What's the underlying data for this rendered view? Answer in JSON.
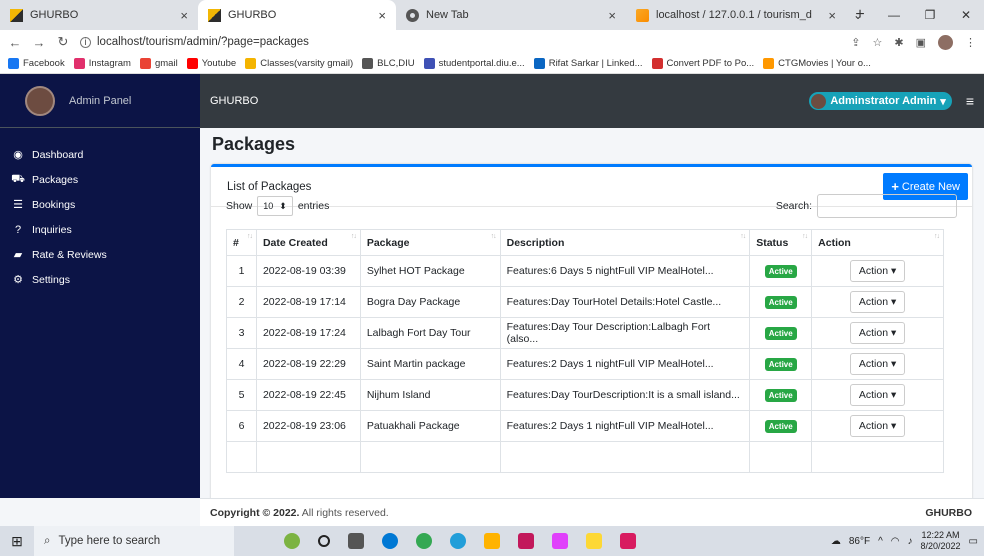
{
  "browser": {
    "tabs": [
      {
        "title": "GHURBO",
        "close": "×",
        "active": false,
        "fav": "ghurbo"
      },
      {
        "title": "GHURBO",
        "close": "×",
        "active": true,
        "fav": "ghurbo"
      },
      {
        "title": "New Tab",
        "close": "×",
        "active": false,
        "fav": "newtab"
      },
      {
        "title": "localhost / 127.0.0.1 / tourism_d",
        "close": "×",
        "active": false,
        "fav": "xampp"
      }
    ],
    "new_tab": "+",
    "url": "localhost/tourism/admin/?page=packages",
    "bookmarks": [
      {
        "label": "Facebook",
        "color": "#1877f2"
      },
      {
        "label": "Instagram",
        "color": "#e1306c"
      },
      {
        "label": "gmail",
        "color": "#ea4335"
      },
      {
        "label": "Youtube",
        "color": "#ff0000"
      },
      {
        "label": "Classes(varsity gmail)",
        "color": "#f4b400"
      },
      {
        "label": "BLC,DIU",
        "color": "#555555"
      },
      {
        "label": "studentportal.diu.e...",
        "color": "#3f51b5"
      },
      {
        "label": "Rifat Sarkar | Linked...",
        "color": "#0a66c2"
      },
      {
        "label": "Convert PDF to Po...",
        "color": "#d32f2f"
      },
      {
        "label": "CTGMovies | Your o...",
        "color": "#ff9800"
      }
    ]
  },
  "sidebar": {
    "brand": "Admin Panel",
    "items": [
      {
        "label": "Dashboard",
        "icon": "◉"
      },
      {
        "label": "Packages",
        "icon": "⛟"
      },
      {
        "label": "Bookings",
        "icon": "☰"
      },
      {
        "label": "Inquiries",
        "icon": "?"
      },
      {
        "label": "Rate & Reviews",
        "icon": "▰"
      },
      {
        "label": "Settings",
        "icon": "⚙"
      }
    ]
  },
  "topnav": {
    "title": "GHURBO",
    "user": "Adminstrator Admin",
    "caret": "▾",
    "menu_icon": "≡"
  },
  "page": {
    "title": "Packages",
    "card_title": "List of Packages",
    "create_btn": "Create New",
    "show": "Show",
    "entries_value": "10",
    "entries": "entries",
    "search_label": "Search:"
  },
  "table": {
    "headers": [
      "#",
      "Date Created",
      "Package",
      "Description",
      "Status",
      "Action"
    ],
    "rows": [
      {
        "num": "1",
        "date": "2022-08-19 03:39",
        "package": "Sylhet HOT Package",
        "desc": "Features:6 Days 5 nightFull VIP MealHotel...",
        "status": "Active",
        "action": "Action"
      },
      {
        "num": "2",
        "date": "2022-08-19 17:14",
        "package": "Bogra Day Package",
        "desc": "Features:Day TourHotel Details:Hotel Castle...",
        "status": "Active",
        "action": "Action"
      },
      {
        "num": "3",
        "date": "2022-08-19 17:24",
        "package": "Lalbagh Fort Day Tour",
        "desc": "Features:Day Tour Description:Lalbagh Fort (also...",
        "status": "Active",
        "action": "Action"
      },
      {
        "num": "4",
        "date": "2022-08-19 22:29",
        "package": "Saint Martin package",
        "desc": "Features:2 Days 1 nightFull VIP MealHotel...",
        "status": "Active",
        "action": "Action"
      },
      {
        "num": "5",
        "date": "2022-08-19 22:45",
        "package": "Nijhum Island",
        "desc": "Features:Day TourDescription:It is a small island...",
        "status": "Active",
        "action": "Action"
      },
      {
        "num": "6",
        "date": "2022-08-19 23:06",
        "package": "Patuakhali Package",
        "desc": "Features:2 Days 1 nightFull VIP MealHotel...",
        "status": "Active",
        "action": "Action"
      }
    ]
  },
  "footer": {
    "copyright_bold": "Copyright © 2022.",
    "copyright_rest": "All rights reserved.",
    "brand": "GHURBO"
  },
  "taskbar": {
    "search": "Type here to search",
    "weather": "86°F",
    "time": "12:22 AM",
    "date": "8/20/2022"
  }
}
